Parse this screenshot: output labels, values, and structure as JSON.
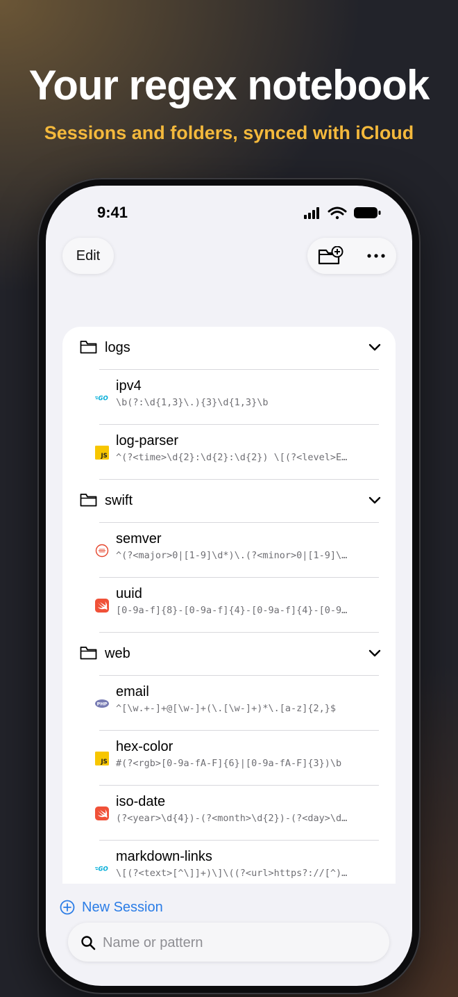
{
  "headline": "Your regex notebook",
  "subheadline": "Sessions and folders, synced with iCloud",
  "status_bar": {
    "time": "9:41"
  },
  "toolbar": {
    "edit_label": "Edit"
  },
  "folders": [
    {
      "name": "logs",
      "sessions": [
        {
          "name": "ipv4",
          "pattern": "\\b(?:\\d{1,3}\\.){3}\\d{1,3}\\b",
          "language": "go"
        },
        {
          "name": "log-parser",
          "pattern": "^(?<time>\\d{2}:\\d{2}:\\d{2}) \\[(?<level>E…",
          "language": "javascript"
        }
      ]
    },
    {
      "name": "swift",
      "sessions": [
        {
          "name": "semver",
          "pattern": "^(?<major>0|[1-9]\\d*)\\.(?<minor>0|[1-9]\\…",
          "language": "scala"
        },
        {
          "name": "uuid",
          "pattern": "[0-9a-f]{8}-[0-9a-f]{4}-[0-9a-f]{4}-[0-9…",
          "language": "swift"
        }
      ]
    },
    {
      "name": "web",
      "sessions": [
        {
          "name": "email",
          "pattern": "^[\\w.+-]+@[\\w-]+(\\.[\\w-]+)*\\.[a-z]{2,}$",
          "language": "php"
        },
        {
          "name": "hex-color",
          "pattern": "#(?<rgb>[0-9a-fA-F]{6}|[0-9a-fA-F]{3})\\b",
          "language": "javascript"
        },
        {
          "name": "iso-date",
          "pattern": "(?<year>\\d{4})-(?<month>\\d{2})-(?<day>\\d…",
          "language": "swift"
        },
        {
          "name": "markdown-links",
          "pattern": "\\[(?<text>[^\\]]+)\\]\\((?<url>https?://[^)…",
          "language": "go"
        }
      ]
    }
  ],
  "bottom": {
    "new_session_label": "New Session",
    "search_placeholder": "Name or pattern"
  },
  "icons": {
    "go": "go-logo-icon",
    "javascript": "js-logo-icon",
    "scala": "scala-logo-icon",
    "swift": "swift-logo-icon",
    "php": "php-logo-icon"
  },
  "colors": {
    "accent": "#2a7ce6",
    "subheadline": "#f4b93c",
    "go": "#00acd7",
    "javascript": "#f7c600",
    "swift": "#f05138",
    "php": "#777bb3",
    "scala": "#e5452c"
  }
}
